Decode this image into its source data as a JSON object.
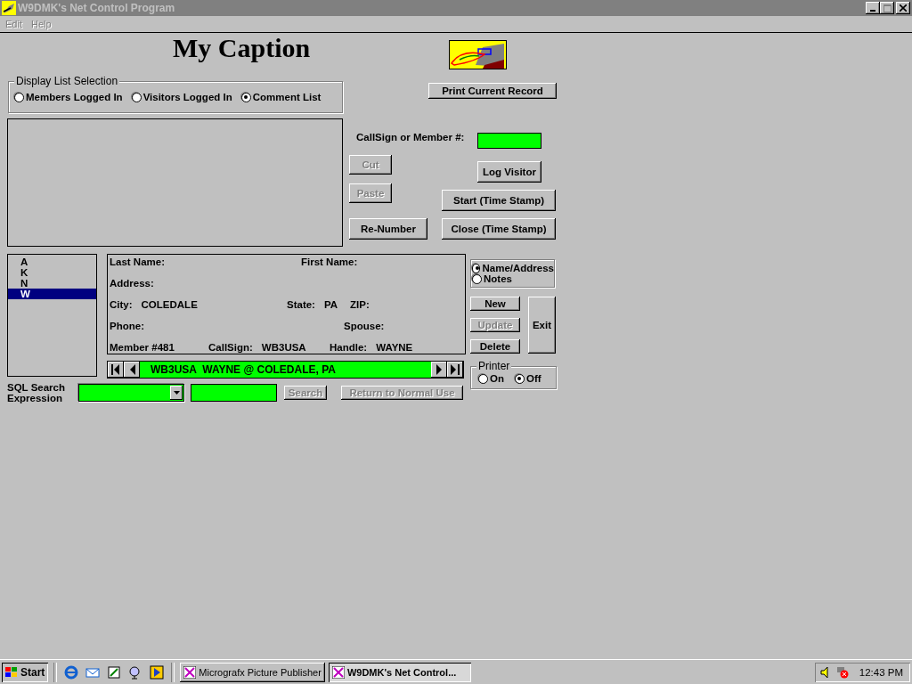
{
  "window": {
    "title": "W9DMK's Net Control Program"
  },
  "menu": [
    {
      "label": "Edit",
      "disabled": true
    },
    {
      "label": "Help",
      "disabled": true
    }
  ],
  "caption": "My Caption",
  "display_list": {
    "label": "Display List Selection",
    "options": [
      {
        "label": "Members Logged In",
        "selected": false
      },
      {
        "label": "Visitors Logged In",
        "selected": false
      },
      {
        "label": "Comment List",
        "selected": true
      }
    ]
  },
  "print_button": {
    "label": "Print Current Record",
    "disabled": false
  },
  "callsign": {
    "label": "CallSign or Member #:"
  },
  "edit_buttons": [
    {
      "label": "Cut",
      "disabled": true
    },
    {
      "label": "Paste",
      "disabled": true
    },
    {
      "label": "Re-Number",
      "disabled": false
    },
    {
      "label": "Log Visitor",
      "disabled": false
    },
    {
      "label": "Start (Time Stamp)",
      "disabled": false
    },
    {
      "label": "Close (Time Stamp)",
      "disabled": false
    }
  ],
  "index_list": [
    {
      "label": "A",
      "selected": false
    },
    {
      "label": "K",
      "selected": false
    },
    {
      "label": "N",
      "selected": false
    },
    {
      "label": "W",
      "selected": true
    }
  ],
  "record": [
    {
      "label": "Last Name:"
    },
    {
      "label": "First Name:"
    },
    {
      "label": "Address:"
    },
    {
      "label": "City:",
      "value": "COLEDALE"
    },
    {
      "label": "State:",
      "value": "PA"
    },
    {
      "label": "ZIP:"
    },
    {
      "label": "Phone:"
    },
    {
      "label": "Spouse:"
    },
    {
      "label": "Member #481"
    },
    {
      "label": "CallSign:",
      "value": "WB3USA"
    },
    {
      "label": "Handle:",
      "value": "WAYNE"
    }
  ],
  "navigator": {
    "text": "WB3USA  WAYNE @ COLEDALE, PA"
  },
  "view_options": [
    {
      "label": "Name/Address",
      "selected": true
    },
    {
      "label": "Notes",
      "selected": false
    }
  ],
  "record_buttons": [
    {
      "label": "New",
      "disabled": false
    },
    {
      "label": "Update",
      "disabled": true
    },
    {
      "label": "Delete",
      "disabled": false
    },
    {
      "label": "Exit",
      "disabled": false
    }
  ],
  "printer": {
    "label": "Printer",
    "options": [
      {
        "label": "On",
        "selected": false
      },
      {
        "label": "Off",
        "selected": true
      }
    ]
  },
  "sql": {
    "label": "SQL Search Expression",
    "search": {
      "label": "Search",
      "disabled": true
    },
    "reset": {
      "label": "Return to Normal Use",
      "disabled": true
    }
  },
  "taskbar": {
    "start": "Start",
    "tasks": [
      {
        "label": "Micrografx Picture Publisher",
        "selected": false
      },
      {
        "label": "W9DMK's Net Control...",
        "selected": true
      }
    ],
    "clock": "12:43 PM"
  }
}
